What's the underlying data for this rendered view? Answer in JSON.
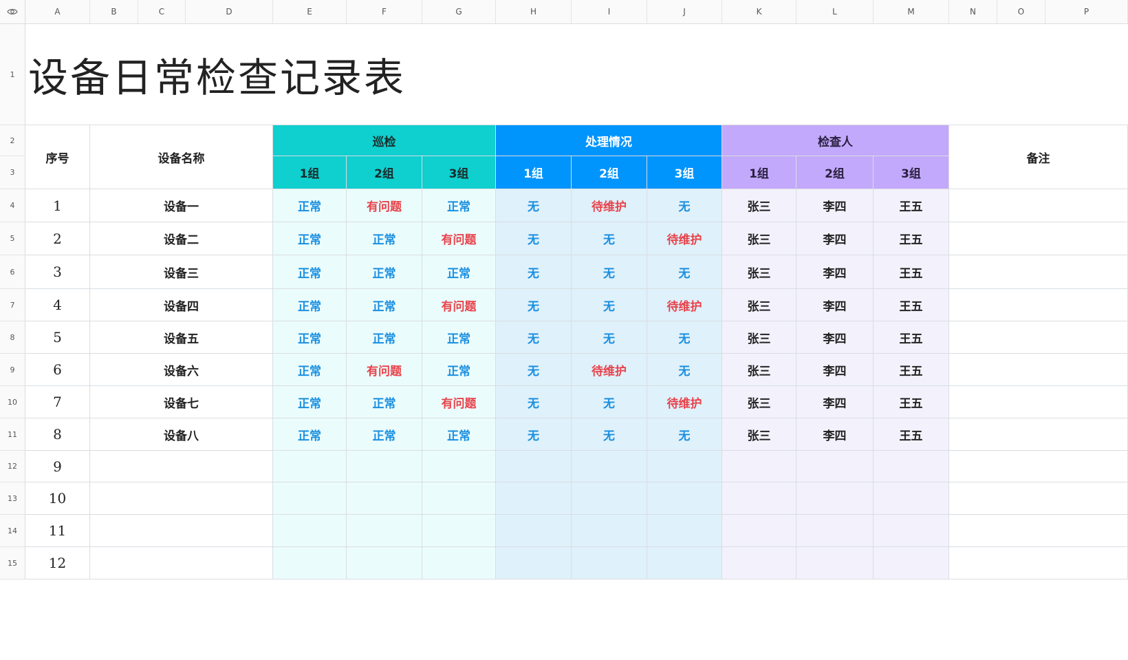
{
  "columns": [
    "A",
    "B",
    "C",
    "D",
    "E",
    "F",
    "G",
    "H",
    "I",
    "J",
    "K",
    "L",
    "M",
    "N",
    "O",
    "P"
  ],
  "rows": [
    "1",
    "2",
    "3",
    "4",
    "5",
    "6",
    "7",
    "8",
    "9",
    "10",
    "11",
    "12",
    "13",
    "14",
    "15"
  ],
  "title": "设备日常检查记录表",
  "headers": {
    "seq": "序号",
    "device_name": "设备名称",
    "patrol": "巡检",
    "handling": "处理情况",
    "inspector": "检查人",
    "remark": "备注",
    "sub": [
      "1组",
      "2组",
      "3组"
    ]
  },
  "records": [
    {
      "seq": "1",
      "name": "设备一",
      "patrol": [
        "正常",
        "有问题",
        "正常"
      ],
      "handling": [
        "无",
        "待维护",
        "无"
      ],
      "inspector": [
        "张三",
        "李四",
        "王五"
      ]
    },
    {
      "seq": "2",
      "name": "设备二",
      "patrol": [
        "正常",
        "正常",
        "有问题"
      ],
      "handling": [
        "无",
        "无",
        "待维护"
      ],
      "inspector": [
        "张三",
        "李四",
        "王五"
      ]
    },
    {
      "seq": "3",
      "name": "设备三",
      "patrol": [
        "正常",
        "正常",
        "正常"
      ],
      "handling": [
        "无",
        "无",
        "无"
      ],
      "inspector": [
        "张三",
        "李四",
        "王五"
      ]
    },
    {
      "seq": "4",
      "name": "设备四",
      "patrol": [
        "正常",
        "正常",
        "有问题"
      ],
      "handling": [
        "无",
        "无",
        "待维护"
      ],
      "inspector": [
        "张三",
        "李四",
        "王五"
      ]
    },
    {
      "seq": "5",
      "name": "设备五",
      "patrol": [
        "正常",
        "正常",
        "正常"
      ],
      "handling": [
        "无",
        "无",
        "无"
      ],
      "inspector": [
        "张三",
        "李四",
        "王五"
      ]
    },
    {
      "seq": "6",
      "name": "设备六",
      "patrol": [
        "正常",
        "有问题",
        "正常"
      ],
      "handling": [
        "无",
        "待维护",
        "无"
      ],
      "inspector": [
        "张三",
        "李四",
        "王五"
      ]
    },
    {
      "seq": "7",
      "name": "设备七",
      "patrol": [
        "正常",
        "正常",
        "有问题"
      ],
      "handling": [
        "无",
        "无",
        "待维护"
      ],
      "inspector": [
        "张三",
        "李四",
        "王五"
      ]
    },
    {
      "seq": "8",
      "name": "设备八",
      "patrol": [
        "正常",
        "正常",
        "正常"
      ],
      "handling": [
        "无",
        "无",
        "无"
      ],
      "inspector": [
        "张三",
        "李四",
        "王五"
      ]
    },
    {
      "seq": "9",
      "name": "",
      "patrol": [
        "",
        "",
        ""
      ],
      "handling": [
        "",
        "",
        ""
      ],
      "inspector": [
        "",
        "",
        ""
      ]
    },
    {
      "seq": "10",
      "name": "",
      "patrol": [
        "",
        "",
        ""
      ],
      "handling": [
        "",
        "",
        ""
      ],
      "inspector": [
        "",
        "",
        ""
      ]
    },
    {
      "seq": "11",
      "name": "",
      "patrol": [
        "",
        "",
        ""
      ],
      "handling": [
        "",
        "",
        ""
      ],
      "inspector": [
        "",
        "",
        ""
      ]
    },
    {
      "seq": "12",
      "name": "",
      "patrol": [
        "",
        "",
        ""
      ],
      "handling": [
        "",
        "",
        ""
      ],
      "inspector": [
        "",
        "",
        ""
      ]
    }
  ],
  "colors": {
    "patrol_header": "#0fcfcf",
    "handling_header": "#0094fd",
    "inspector_header": "#c3a9fb",
    "status_ok": "#1a8fe0",
    "status_problem": "#e8434b"
  },
  "icons": {
    "corner": "eye-icon"
  }
}
